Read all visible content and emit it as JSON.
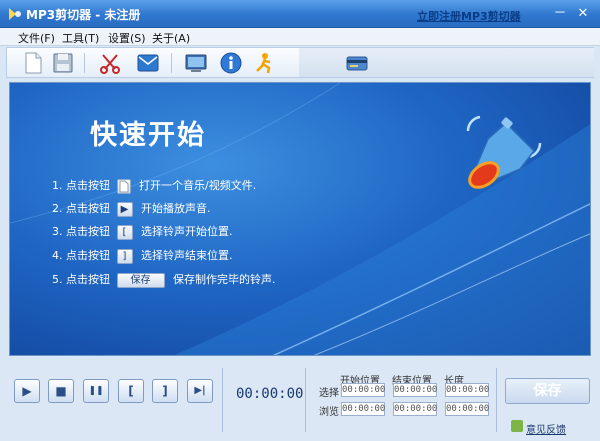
{
  "window": {
    "title": "MP3剪切器 - 未注册",
    "minimize": "－",
    "close": "✕"
  },
  "menu": [
    {
      "label": "文件(F)"
    },
    {
      "label": "工具(T)"
    },
    {
      "label": "设置(S)"
    },
    {
      "label": "关于(A)"
    }
  ],
  "toolbar": {
    "icons": [
      "new-file-icon",
      "save-disk-icon",
      "scissors-icon",
      "mail-icon",
      "monitor-icon",
      "info-icon",
      "running-man-icon",
      "card-icon"
    ],
    "register_link": "立即注册MP3剪切器"
  },
  "main": {
    "title": "快速开始",
    "steps": [
      {
        "num": "1.",
        "pre": "点击按钮",
        "button": "",
        "post": "打开一个音乐/视频文件."
      },
      {
        "num": "2.",
        "pre": "点击按钮",
        "button": "▶",
        "post": "开始播放声音."
      },
      {
        "num": "3.",
        "pre": "点击按钮",
        "button": "[",
        "post": "选择铃声开始位置."
      },
      {
        "num": "4.",
        "pre": "点击按钮",
        "button": "]",
        "post": "选择铃声结束位置."
      },
      {
        "num": "5.",
        "pre": "点击按钮",
        "button": "保存",
        "post": "保存制作完毕的铃声."
      }
    ]
  },
  "transport": {
    "buttons": [
      "▶",
      "■",
      "❚❚",
      "[",
      "]",
      "▶|"
    ],
    "time": "00:00:00",
    "columns": [
      "开始位置",
      "结束位置",
      "长度"
    ],
    "rows": [
      {
        "label": "选择",
        "values": [
          "00:00:00",
          "00:00:00",
          "00:00:00"
        ]
      },
      {
        "label": "浏览",
        "values": [
          "00:00:00",
          "00:00:00",
          "00:00:00"
        ]
      }
    ],
    "save_label": "保存",
    "feedback": "意见反馈"
  },
  "colors": {
    "accent": "#2f77cf",
    "panel": "#1f66c4",
    "link": "#0a3d86"
  }
}
